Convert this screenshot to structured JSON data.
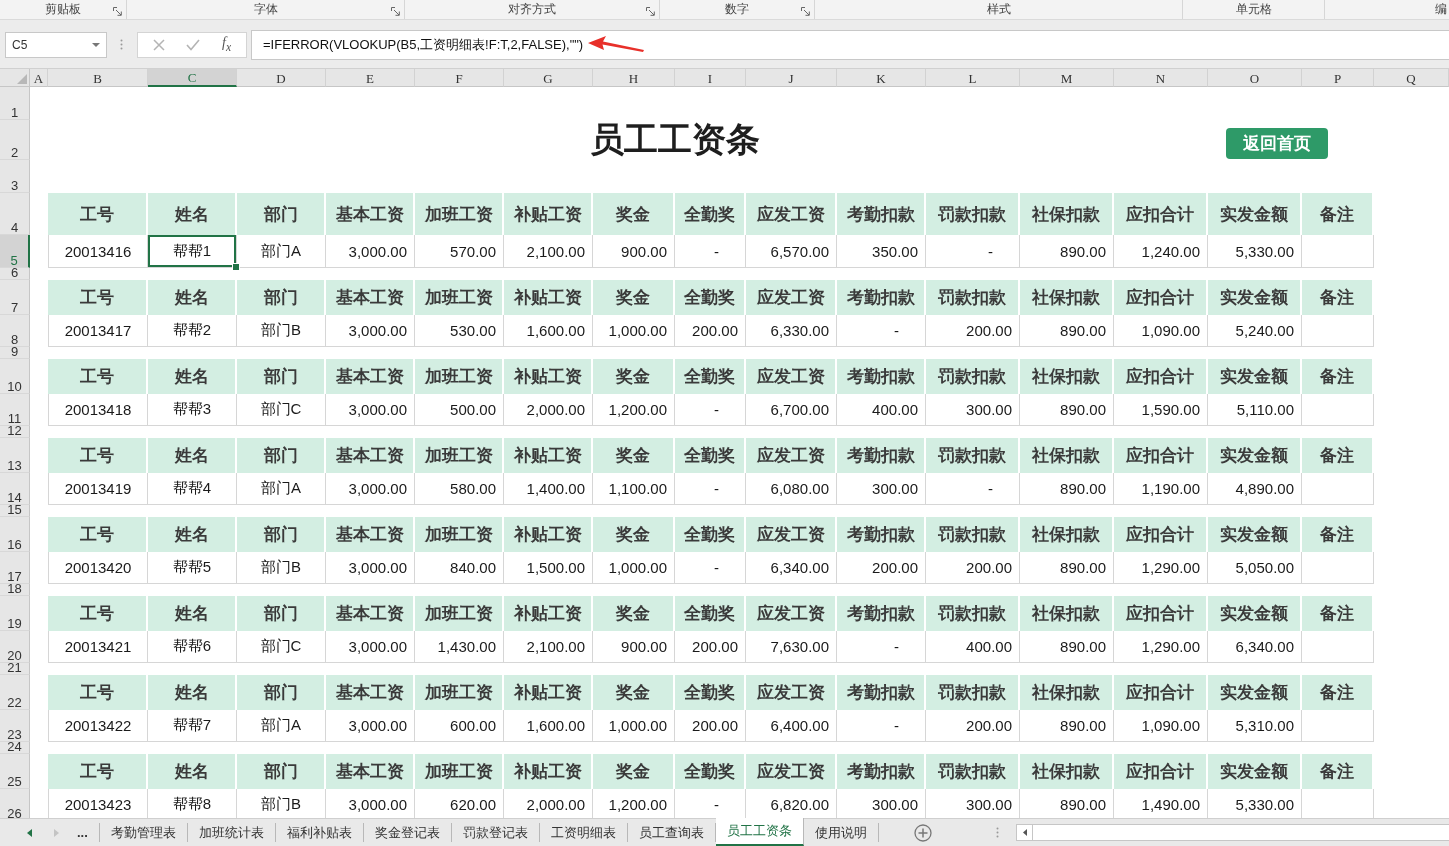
{
  "ribbon_groups": [
    {
      "label": "剪贴板",
      "launcher": true
    },
    {
      "label": "字体",
      "launcher": true
    },
    {
      "label": "对齐方式",
      "launcher": true
    },
    {
      "label": "数字",
      "launcher": true
    },
    {
      "label": "样式",
      "launcher": false
    },
    {
      "label": "单元格",
      "launcher": false
    },
    {
      "label": "编",
      "launcher": false
    }
  ],
  "name_box": {
    "value": "C5"
  },
  "formula_bar": {
    "insert_function": "f$_{x}$",
    "value": "=IFERROR(VLOOKUP(B5,工资明细表!F:T,2,FALSE),\"\")"
  },
  "column_headers": [
    {
      "label": "A",
      "selected": false
    },
    {
      "label": "B",
      "selected": false
    },
    {
      "label": "C",
      "selected": true
    },
    {
      "label": "D",
      "selected": false
    },
    {
      "label": "E",
      "selected": false
    },
    {
      "label": "F",
      "selected": false
    },
    {
      "label": "G",
      "selected": false
    },
    {
      "label": "H",
      "selected": false
    },
    {
      "label": "I",
      "selected": false
    },
    {
      "label": "J",
      "selected": false
    },
    {
      "label": "K",
      "selected": false
    },
    {
      "label": "L",
      "selected": false
    },
    {
      "label": "M",
      "selected": false
    },
    {
      "label": "N",
      "selected": false
    },
    {
      "label": "O",
      "selected": false
    },
    {
      "label": "P",
      "selected": false
    },
    {
      "label": "Q",
      "selected": false
    }
  ],
  "row_headers": [
    {
      "label": "1",
      "selected": false
    },
    {
      "label": "2",
      "selected": false
    },
    {
      "label": "3",
      "selected": false
    },
    {
      "label": "4",
      "selected": false
    },
    {
      "label": "5",
      "selected": true
    },
    {
      "label": "6",
      "selected": false
    },
    {
      "label": "7",
      "selected": false
    },
    {
      "label": "8",
      "selected": false
    },
    {
      "label": "9",
      "selected": false
    },
    {
      "label": "10",
      "selected": false
    },
    {
      "label": "11",
      "selected": false
    },
    {
      "label": "12",
      "selected": false
    },
    {
      "label": "13",
      "selected": false
    },
    {
      "label": "14",
      "selected": false
    },
    {
      "label": "15",
      "selected": false
    },
    {
      "label": "16",
      "selected": false
    },
    {
      "label": "17",
      "selected": false
    },
    {
      "label": "18",
      "selected": false
    },
    {
      "label": "19",
      "selected": false
    },
    {
      "label": "20",
      "selected": false
    },
    {
      "label": "21",
      "selected": false
    },
    {
      "label": "22",
      "selected": false
    },
    {
      "label": "23",
      "selected": false
    },
    {
      "label": "24",
      "selected": false
    },
    {
      "label": "25",
      "selected": false
    },
    {
      "label": "26",
      "selected": false
    }
  ],
  "title": "员工工资条",
  "home_button": {
    "label": "返回首页"
  },
  "slips": [
    {
      "headers": [
        "工号",
        "姓名",
        "部门",
        "基本工资",
        "加班工资",
        "补贴工资",
        "奖金",
        "全勤奖",
        "应发工资",
        "考勤扣款",
        "罚款扣款",
        "社保扣款",
        "应扣合计",
        "实发金额",
        "备注"
      ],
      "cells": [
        {
          "text": "20013416",
          "selected": false
        },
        {
          "text": "帮帮1",
          "selected": true
        },
        {
          "text": "部门A",
          "selected": false
        },
        {
          "text": "3,000.00",
          "selected": false
        },
        {
          "text": "570.00",
          "selected": false
        },
        {
          "text": "2,100.00",
          "selected": false
        },
        {
          "text": "900.00",
          "selected": false
        },
        {
          "text": "-",
          "selected": false
        },
        {
          "text": "6,570.00",
          "selected": false
        },
        {
          "text": "350.00",
          "selected": false
        },
        {
          "text": "-",
          "selected": false
        },
        {
          "text": "890.00",
          "selected": false
        },
        {
          "text": "1,240.00",
          "selected": false
        },
        {
          "text": "5,330.00",
          "selected": false
        }
      ]
    },
    {
      "headers": [
        "工号",
        "姓名",
        "部门",
        "基本工资",
        "加班工资",
        "补贴工资",
        "奖金",
        "全勤奖",
        "应发工资",
        "考勤扣款",
        "罚款扣款",
        "社保扣款",
        "应扣合计",
        "实发金额",
        "备注"
      ],
      "cells": [
        {
          "text": "20013417",
          "selected": false
        },
        {
          "text": "帮帮2",
          "selected": false
        },
        {
          "text": "部门B",
          "selected": false
        },
        {
          "text": "3,000.00",
          "selected": false
        },
        {
          "text": "530.00",
          "selected": false
        },
        {
          "text": "1,600.00",
          "selected": false
        },
        {
          "text": "1,000.00",
          "selected": false
        },
        {
          "text": "200.00",
          "selected": false
        },
        {
          "text": "6,330.00",
          "selected": false
        },
        {
          "text": "-",
          "selected": false
        },
        {
          "text": "200.00",
          "selected": false
        },
        {
          "text": "890.00",
          "selected": false
        },
        {
          "text": "1,090.00",
          "selected": false
        },
        {
          "text": "5,240.00",
          "selected": false
        }
      ]
    },
    {
      "headers": [
        "工号",
        "姓名",
        "部门",
        "基本工资",
        "加班工资",
        "补贴工资",
        "奖金",
        "全勤奖",
        "应发工资",
        "考勤扣款",
        "罚款扣款",
        "社保扣款",
        "应扣合计",
        "实发金额",
        "备注"
      ],
      "cells": [
        {
          "text": "20013418",
          "selected": false
        },
        {
          "text": "帮帮3",
          "selected": false
        },
        {
          "text": "部门C",
          "selected": false
        },
        {
          "text": "3,000.00",
          "selected": false
        },
        {
          "text": "500.00",
          "selected": false
        },
        {
          "text": "2,000.00",
          "selected": false
        },
        {
          "text": "1,200.00",
          "selected": false
        },
        {
          "text": "-",
          "selected": false
        },
        {
          "text": "6,700.00",
          "selected": false
        },
        {
          "text": "400.00",
          "selected": false
        },
        {
          "text": "300.00",
          "selected": false
        },
        {
          "text": "890.00",
          "selected": false
        },
        {
          "text": "1,590.00",
          "selected": false
        },
        {
          "text": "5,110.00",
          "selected": false
        }
      ]
    },
    {
      "headers": [
        "工号",
        "姓名",
        "部门",
        "基本工资",
        "加班工资",
        "补贴工资",
        "奖金",
        "全勤奖",
        "应发工资",
        "考勤扣款",
        "罚款扣款",
        "社保扣款",
        "应扣合计",
        "实发金额",
        "备注"
      ],
      "cells": [
        {
          "text": "20013419",
          "selected": false
        },
        {
          "text": "帮帮4",
          "selected": false
        },
        {
          "text": "部门A",
          "selected": false
        },
        {
          "text": "3,000.00",
          "selected": false
        },
        {
          "text": "580.00",
          "selected": false
        },
        {
          "text": "1,400.00",
          "selected": false
        },
        {
          "text": "1,100.00",
          "selected": false
        },
        {
          "text": "-",
          "selected": false
        },
        {
          "text": "6,080.00",
          "selected": false
        },
        {
          "text": "300.00",
          "selected": false
        },
        {
          "text": "-",
          "selected": false
        },
        {
          "text": "890.00",
          "selected": false
        },
        {
          "text": "1,190.00",
          "selected": false
        },
        {
          "text": "4,890.00",
          "selected": false
        }
      ]
    },
    {
      "headers": [
        "工号",
        "姓名",
        "部门",
        "基本工资",
        "加班工资",
        "补贴工资",
        "奖金",
        "全勤奖",
        "应发工资",
        "考勤扣款",
        "罚款扣款",
        "社保扣款",
        "应扣合计",
        "实发金额",
        "备注"
      ],
      "cells": [
        {
          "text": "20013420",
          "selected": false
        },
        {
          "text": "帮帮5",
          "selected": false
        },
        {
          "text": "部门B",
          "selected": false
        },
        {
          "text": "3,000.00",
          "selected": false
        },
        {
          "text": "840.00",
          "selected": false
        },
        {
          "text": "1,500.00",
          "selected": false
        },
        {
          "text": "1,000.00",
          "selected": false
        },
        {
          "text": "-",
          "selected": false
        },
        {
          "text": "6,340.00",
          "selected": false
        },
        {
          "text": "200.00",
          "selected": false
        },
        {
          "text": "200.00",
          "selected": false
        },
        {
          "text": "890.00",
          "selected": false
        },
        {
          "text": "1,290.00",
          "selected": false
        },
        {
          "text": "5,050.00",
          "selected": false
        }
      ]
    },
    {
      "headers": [
        "工号",
        "姓名",
        "部门",
        "基本工资",
        "加班工资",
        "补贴工资",
        "奖金",
        "全勤奖",
        "应发工资",
        "考勤扣款",
        "罚款扣款",
        "社保扣款",
        "应扣合计",
        "实发金额",
        "备注"
      ],
      "cells": [
        {
          "text": "20013421",
          "selected": false
        },
        {
          "text": "帮帮6",
          "selected": false
        },
        {
          "text": "部门C",
          "selected": false
        },
        {
          "text": "3,000.00",
          "selected": false
        },
        {
          "text": "1,430.00",
          "selected": false
        },
        {
          "text": "2,100.00",
          "selected": false
        },
        {
          "text": "900.00",
          "selected": false
        },
        {
          "text": "200.00",
          "selected": false
        },
        {
          "text": "7,630.00",
          "selected": false
        },
        {
          "text": "-",
          "selected": false
        },
        {
          "text": "400.00",
          "selected": false
        },
        {
          "text": "890.00",
          "selected": false
        },
        {
          "text": "1,290.00",
          "selected": false
        },
        {
          "text": "6,340.00",
          "selected": false
        }
      ]
    },
    {
      "headers": [
        "工号",
        "姓名",
        "部门",
        "基本工资",
        "加班工资",
        "补贴工资",
        "奖金",
        "全勤奖",
        "应发工资",
        "考勤扣款",
        "罚款扣款",
        "社保扣款",
        "应扣合计",
        "实发金额",
        "备注"
      ],
      "cells": [
        {
          "text": "20013422",
          "selected": false
        },
        {
          "text": "帮帮7",
          "selected": false
        },
        {
          "text": "部门A",
          "selected": false
        },
        {
          "text": "3,000.00",
          "selected": false
        },
        {
          "text": "600.00",
          "selected": false
        },
        {
          "text": "1,600.00",
          "selected": false
        },
        {
          "text": "1,000.00",
          "selected": false
        },
        {
          "text": "200.00",
          "selected": false
        },
        {
          "text": "6,400.00",
          "selected": false
        },
        {
          "text": "-",
          "selected": false
        },
        {
          "text": "200.00",
          "selected": false
        },
        {
          "text": "890.00",
          "selected": false
        },
        {
          "text": "1,090.00",
          "selected": false
        },
        {
          "text": "5,310.00",
          "selected": false
        }
      ]
    },
    {
      "headers": [
        "工号",
        "姓名",
        "部门",
        "基本工资",
        "加班工资",
        "补贴工资",
        "奖金",
        "全勤奖",
        "应发工资",
        "考勤扣款",
        "罚款扣款",
        "社保扣款",
        "应扣合计",
        "实发金额",
        "备注"
      ],
      "cells": [
        {
          "text": "20013423",
          "selected": false
        },
        {
          "text": "帮帮8",
          "selected": false
        },
        {
          "text": "部门B",
          "selected": false
        },
        {
          "text": "3,000.00",
          "selected": false
        },
        {
          "text": "620.00",
          "selected": false
        },
        {
          "text": "2,000.00",
          "selected": false
        },
        {
          "text": "1,200.00",
          "selected": false
        },
        {
          "text": "-",
          "selected": false
        },
        {
          "text": "6,820.00",
          "selected": false
        },
        {
          "text": "300.00",
          "selected": false
        },
        {
          "text": "300.00",
          "selected": false
        },
        {
          "text": "890.00",
          "selected": false
        },
        {
          "text": "1,490.00",
          "selected": false
        },
        {
          "text": "5,330.00",
          "selected": false
        }
      ]
    }
  ],
  "sheet_tabs": {
    "nav": [
      {
        "kind": "prev",
        "disabled": false
      },
      {
        "kind": "next",
        "disabled": true
      }
    ],
    "more": "...",
    "tabs": [
      {
        "label": "考勤管理表",
        "selected": false
      },
      {
        "label": "加班统计表",
        "selected": false
      },
      {
        "label": "福利补贴表",
        "selected": false
      },
      {
        "label": "奖金登记表",
        "selected": false
      },
      {
        "label": "罚款登记表",
        "selected": false
      },
      {
        "label": "工资明细表",
        "selected": false
      },
      {
        "label": "员工查询表",
        "selected": false
      },
      {
        "label": "员工工资条",
        "selected": true
      },
      {
        "label": "使用说明",
        "selected": false
      }
    ]
  }
}
